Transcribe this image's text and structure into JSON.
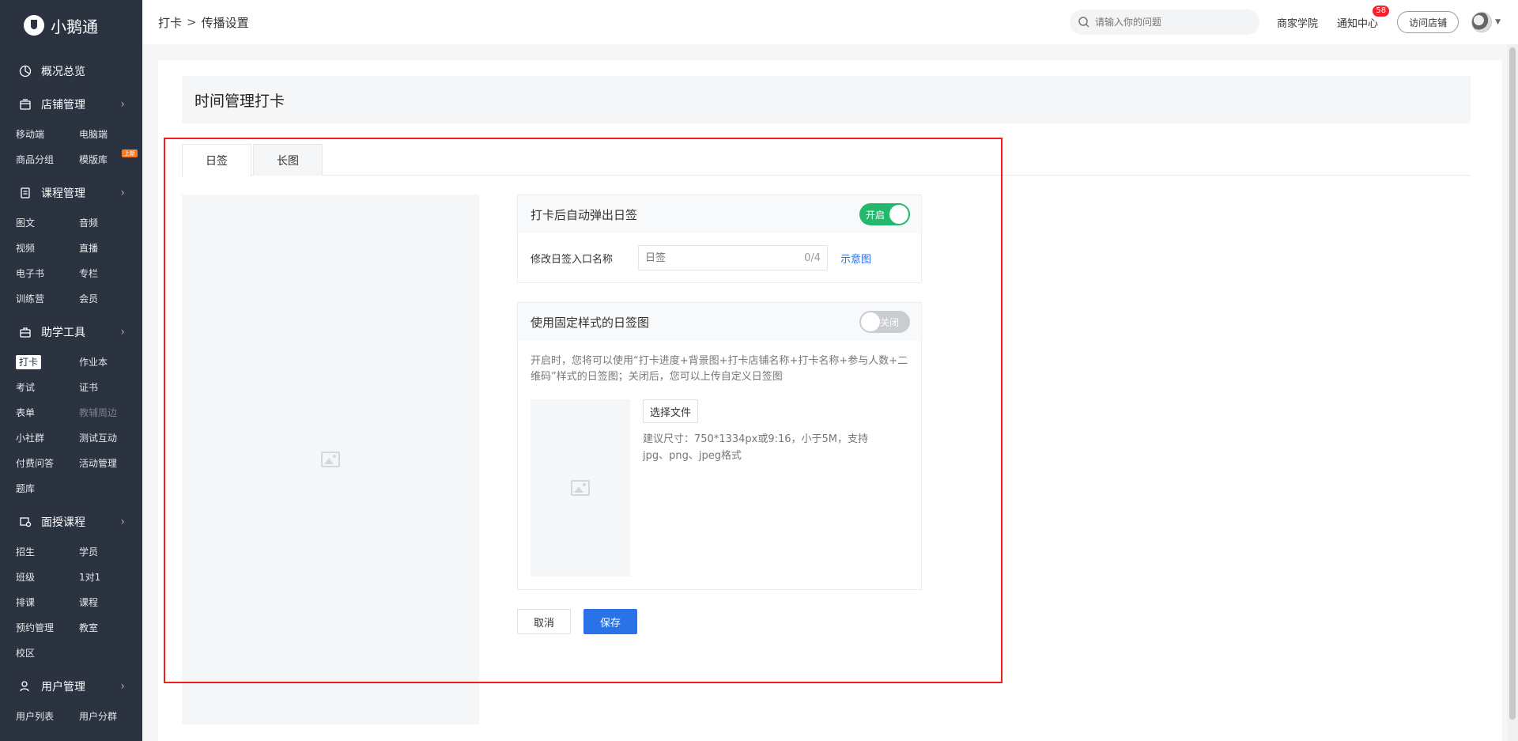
{
  "app": {
    "name": "小鹅通"
  },
  "sidebar": {
    "groups": [
      {
        "title": "概况总览",
        "icon": "overview-icon",
        "has_arrow": false,
        "items": []
      },
      {
        "title": "店铺管理",
        "icon": "store-icon",
        "has_arrow": true,
        "items": [
          {
            "label": "移动端"
          },
          {
            "label": "电脑端"
          },
          {
            "label": "商品分组"
          },
          {
            "label": "模版库",
            "badge": "上新"
          }
        ]
      },
      {
        "title": "课程管理",
        "icon": "course-icon",
        "has_arrow": true,
        "items": [
          {
            "label": "图文"
          },
          {
            "label": "音频"
          },
          {
            "label": "视频"
          },
          {
            "label": "直播"
          },
          {
            "label": "电子书"
          },
          {
            "label": "专栏"
          },
          {
            "label": "训练营"
          },
          {
            "label": "会员"
          }
        ]
      },
      {
        "title": "助学工具",
        "icon": "toolbox-icon",
        "has_arrow": true,
        "items": [
          {
            "label": "打卡",
            "active": true
          },
          {
            "label": "作业本"
          },
          {
            "label": "考试"
          },
          {
            "label": "证书"
          },
          {
            "label": "表单"
          },
          {
            "label": "教辅周边",
            "muted": true
          },
          {
            "label": "小社群"
          },
          {
            "label": "测试互动"
          },
          {
            "label": "付费问答"
          },
          {
            "label": "活动管理"
          },
          {
            "label": "题库"
          }
        ]
      },
      {
        "title": "面授课程",
        "icon": "classroom-icon",
        "has_arrow": true,
        "items": [
          {
            "label": "招生"
          },
          {
            "label": "学员"
          },
          {
            "label": "班级"
          },
          {
            "label": "1对1"
          },
          {
            "label": "排课"
          },
          {
            "label": "课程"
          },
          {
            "label": "预约管理"
          },
          {
            "label": "教室"
          },
          {
            "label": "校区"
          }
        ]
      },
      {
        "title": "用户管理",
        "icon": "user-icon",
        "has_arrow": true,
        "items": [
          {
            "label": "用户列表"
          },
          {
            "label": "用户分群"
          }
        ]
      }
    ]
  },
  "header": {
    "breadcrumb": [
      "打卡",
      "传播设置"
    ],
    "breadcrumb_sep": ">",
    "search_placeholder": "请输入你的问题",
    "links": {
      "academy": "商家学院",
      "notice": "通知中心"
    },
    "notice_count": "58",
    "visit_store": "访问店铺"
  },
  "page": {
    "title": "时间管理打卡",
    "tabs": [
      {
        "label": "日签",
        "active": true
      },
      {
        "label": "长图",
        "active": false
      }
    ],
    "panel_auto": {
      "title": "打卡后自动弹出日签",
      "toggle_label": "开启",
      "toggle_on": true,
      "entry_label": "修改日签入口名称",
      "entry_placeholder": "日签",
      "entry_count": "0/4",
      "example_link": "示意图"
    },
    "panel_fixed": {
      "title": "使用固定样式的日签图",
      "toggle_label": "关闭",
      "toggle_on": false,
      "description": "开启时，您将可以使用“打卡进度+背景图+打卡店铺名称+打卡名称+参与人数+二维码”样式的日签图；关闭后，您可以上传自定义日签图",
      "file_button": "选择文件",
      "hint": "建议尺寸：750*1334px或9:16，小于5M，支持jpg、png、jpeg格式"
    },
    "actions": {
      "cancel": "取消",
      "save": "保存"
    }
  },
  "colors": {
    "sidebar_bg": "#2b3240",
    "accent": "#2a72e8",
    "toggle_on": "#23b86b",
    "highlight": "#f01d1d"
  }
}
